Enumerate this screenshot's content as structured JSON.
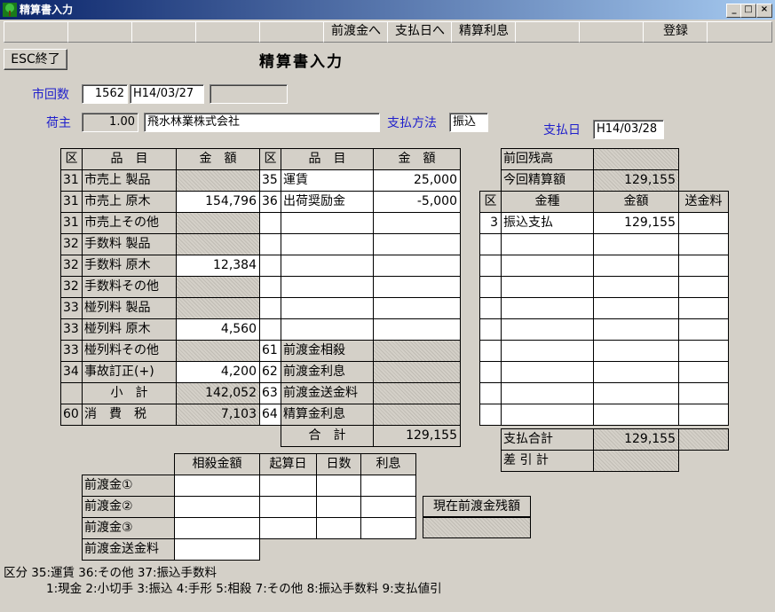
{
  "window": {
    "title": "精算書入力",
    "min": "_",
    "max": "□",
    "close": "×"
  },
  "fkeys": [
    "",
    "",
    "",
    "",
    "",
    "前渡金へ",
    "支払日へ",
    "精算利息",
    "",
    "",
    "登録",
    ""
  ],
  "esc_button": "ESC終了",
  "form_title": "精算書入力",
  "header": {
    "shikaisu_label": "市回数",
    "shikaisu_value": "1562",
    "date_value": "H14/03/27",
    "extra_value": "",
    "ninushi_label": "荷主",
    "ninushi_code": "1.00",
    "ninushi_name": "飛水林業株式会社",
    "payment_method_label": "支払方法",
    "payment_method_value": "振込",
    "payment_date_label": "支払日",
    "payment_date_value": "H14/03/28"
  },
  "left_table": {
    "headers": [
      "区",
      "品　目",
      "金　額",
      "区",
      "品　目",
      "金　額"
    ],
    "rows": [
      [
        "31",
        "市売上 製品",
        "",
        "35",
        "運賃",
        "25,000"
      ],
      [
        "31",
        "市売上 原木",
        "154,796",
        "36",
        "出荷奨励金",
        "-5,000"
      ],
      [
        "31",
        "市売上その他",
        "",
        "",
        "",
        ""
      ],
      [
        "32",
        "手数料 製品",
        "",
        "",
        "",
        ""
      ],
      [
        "32",
        "手数料 原木",
        "12,384",
        "",
        "",
        ""
      ],
      [
        "32",
        "手数料その他",
        "",
        "",
        "",
        ""
      ],
      [
        "33",
        "椪列料 製品",
        "",
        "",
        "",
        ""
      ],
      [
        "33",
        "椪列料 原木",
        "4,560",
        "",
        "",
        ""
      ],
      [
        "33",
        "椪列料その他",
        "",
        "61",
        "前渡金相殺",
        ""
      ],
      [
        "34",
        "事故訂正(+)",
        "4,200",
        "62",
        "前渡金利息",
        ""
      ],
      [
        "",
        "小　計",
        "142,052",
        "63",
        "前渡金送金料",
        ""
      ],
      [
        "60",
        "消　費　税",
        "7,103",
        "64",
        "精算金利息",
        ""
      ]
    ],
    "total_label": "合　計",
    "total_value": "129,155"
  },
  "right_table": {
    "prev_balance_label": "前回残高",
    "prev_balance_value": "",
    "current_label": "今回精算額",
    "current_value": "129,155",
    "headers": [
      "区",
      "金種",
      "金額",
      "送金料"
    ],
    "rows": [
      [
        "3",
        "振込支払",
        "129,155",
        ""
      ],
      [
        "",
        "",
        "",
        ""
      ],
      [
        "",
        "",
        "",
        ""
      ],
      [
        "",
        "",
        "",
        ""
      ],
      [
        "",
        "",
        "",
        ""
      ],
      [
        "",
        "",
        "",
        ""
      ],
      [
        "",
        "",
        "",
        ""
      ],
      [
        "",
        "",
        "",
        ""
      ],
      [
        "",
        "",
        "",
        ""
      ],
      [
        "",
        "",
        "",
        ""
      ]
    ],
    "pay_total_label": "支払合計",
    "pay_total_value": "129,155",
    "diff_label": "差 引 計",
    "diff_value": ""
  },
  "advance_table": {
    "headers": [
      "相殺金額",
      "起算日",
      "日数",
      "利息"
    ],
    "rows": [
      "前渡金①",
      "前渡金②",
      "前渡金③"
    ],
    "fee_label": "前渡金送金料"
  },
  "advance_balance_label": "現在前渡金残額",
  "advance_balance_value": "",
  "legend": {
    "line1": "区分 35:運賃 36:その他 37:振込手数料",
    "line2": "1:現金 2:小切手 3:振込 4:手形 5:相殺 7:その他 8:振込手数料 9:支払値引"
  }
}
